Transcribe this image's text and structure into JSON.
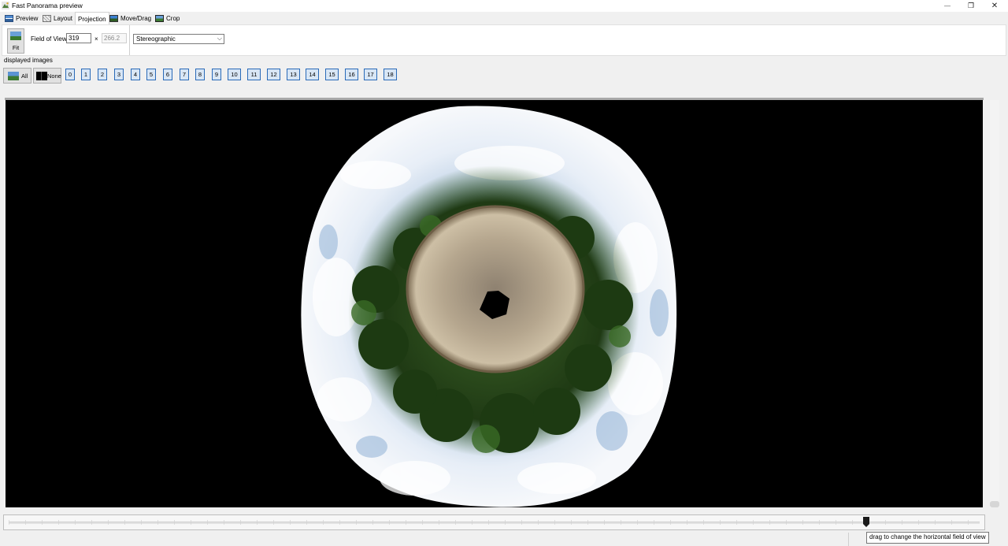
{
  "window": {
    "title": "Fast Panorama preview",
    "minimize": "—",
    "restore": "❐",
    "close": "✕"
  },
  "tabs": [
    {
      "label": "Preview",
      "icon": "preview-icon"
    },
    {
      "label": "Layout",
      "icon": "layout-icon"
    },
    {
      "label": "Projection",
      "icon": "",
      "active": true
    },
    {
      "label": "Move/Drag",
      "icon": "move-drag-icon"
    },
    {
      "label": "Crop",
      "icon": "crop-icon"
    }
  ],
  "projection": {
    "fit_label": "Fit",
    "fov_label": "Field of View",
    "hfov_value": "319",
    "times": "×",
    "vfov_value": "266.2",
    "projection_selected": "Stereographic"
  },
  "images": {
    "label": "displayed images",
    "all_label": "All",
    "none_label": "None",
    "buttons": [
      "0",
      "1",
      "2",
      "3",
      "4",
      "5",
      "6",
      "7",
      "8",
      "9",
      "10",
      "11",
      "12",
      "13",
      "14",
      "15",
      "16",
      "17",
      "18"
    ]
  },
  "fov_slider": {
    "level_fraction": 0.883,
    "tooltip": "drag to change the horizontal field of view"
  },
  "colors": {
    "accent": "#2a6ab8",
    "image_button_fill": "#d8e6f5",
    "canvas_background": "#000000"
  }
}
